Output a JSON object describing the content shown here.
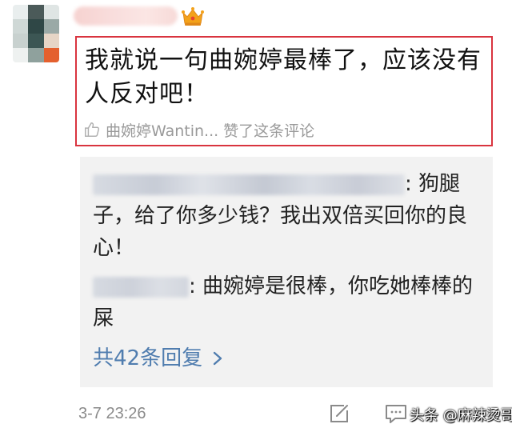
{
  "comment": {
    "text": "我就说一句曲婉婷最棒了，应该没有人反对吧！",
    "like_text": "曲婉婷Wantin... 赞了这条评论"
  },
  "replies": [
    {
      "text": ": 狗腿子，给了你多少钱？我出双倍买回你的良心！"
    },
    {
      "text": ": 曲婉婷是很棒，你吃她棒棒的屎"
    }
  ],
  "more_replies": "共42条回复",
  "timestamp": "3-7 23:26",
  "watermark": "头条 @麻辣烫哥",
  "colors": {
    "highlight_border": "#d9343f",
    "link": "#507daf",
    "reply_bg": "#f2f2f2",
    "muted": "#9a9a9a"
  },
  "icons": {
    "crown": "crown-icon",
    "like": "thumbs-up-icon",
    "chevron": "chevron-right-icon",
    "edit": "edit-icon",
    "comment": "comment-icon"
  }
}
